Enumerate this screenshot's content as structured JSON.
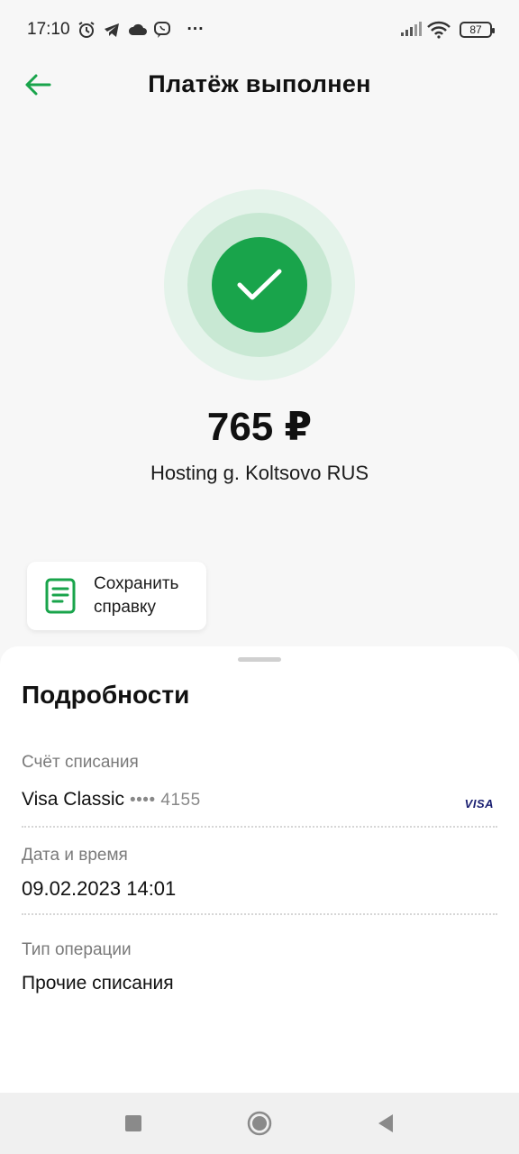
{
  "status_bar": {
    "time": "17:10",
    "battery": "87",
    "more": "···"
  },
  "header": {
    "title": "Платёж выполнен"
  },
  "payment": {
    "amount": "765 ₽",
    "merchant": "Hosting g. Koltsovo RUS"
  },
  "save_receipt": {
    "label": "Сохранить справку"
  },
  "details": {
    "title": "Подробности",
    "account_label": "Счёт списания",
    "account_name": "Visa Classic",
    "account_mask": "•••• 4155",
    "card_brand": "VISA",
    "datetime_label": "Дата и время",
    "datetime_value": "09.02.2023 14:01",
    "operation_label": "Тип операции",
    "operation_value": "Прочие списания"
  },
  "colors": {
    "accent": "#19a44b",
    "background": "#f7f7f7",
    "sheet": "#ffffff"
  }
}
